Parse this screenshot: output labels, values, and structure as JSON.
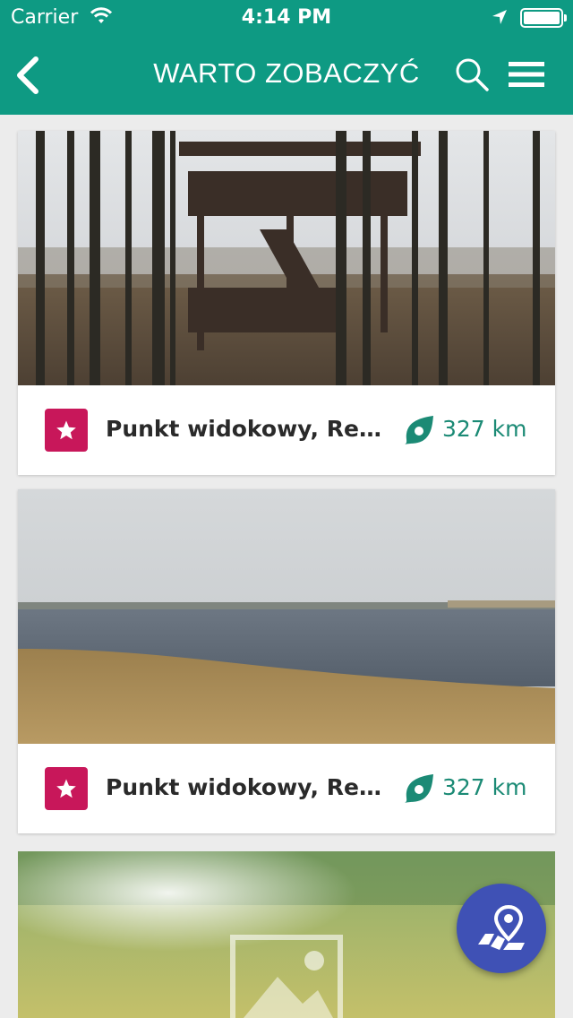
{
  "status": {
    "carrier": "Carrier",
    "time": "4:14 PM"
  },
  "nav": {
    "title": "WARTO ZOBACZYĆ"
  },
  "items": [
    {
      "name": "Punkt widokowy, Rezerwat Beka",
      "distance": "327 km"
    },
    {
      "name": "Punkt widokowy, Rezerwat Beka",
      "distance": "327 km"
    }
  ],
  "colors": {
    "primary": "#0e9a83",
    "badge": "#c8175a",
    "fab": "#3f51b5",
    "distance": "#1b8a75"
  },
  "icons": {
    "back": "chevron-left",
    "search": "magnifier",
    "menu": "hamburger",
    "badge": "star",
    "distance": "compass",
    "fab": "map-pin"
  }
}
